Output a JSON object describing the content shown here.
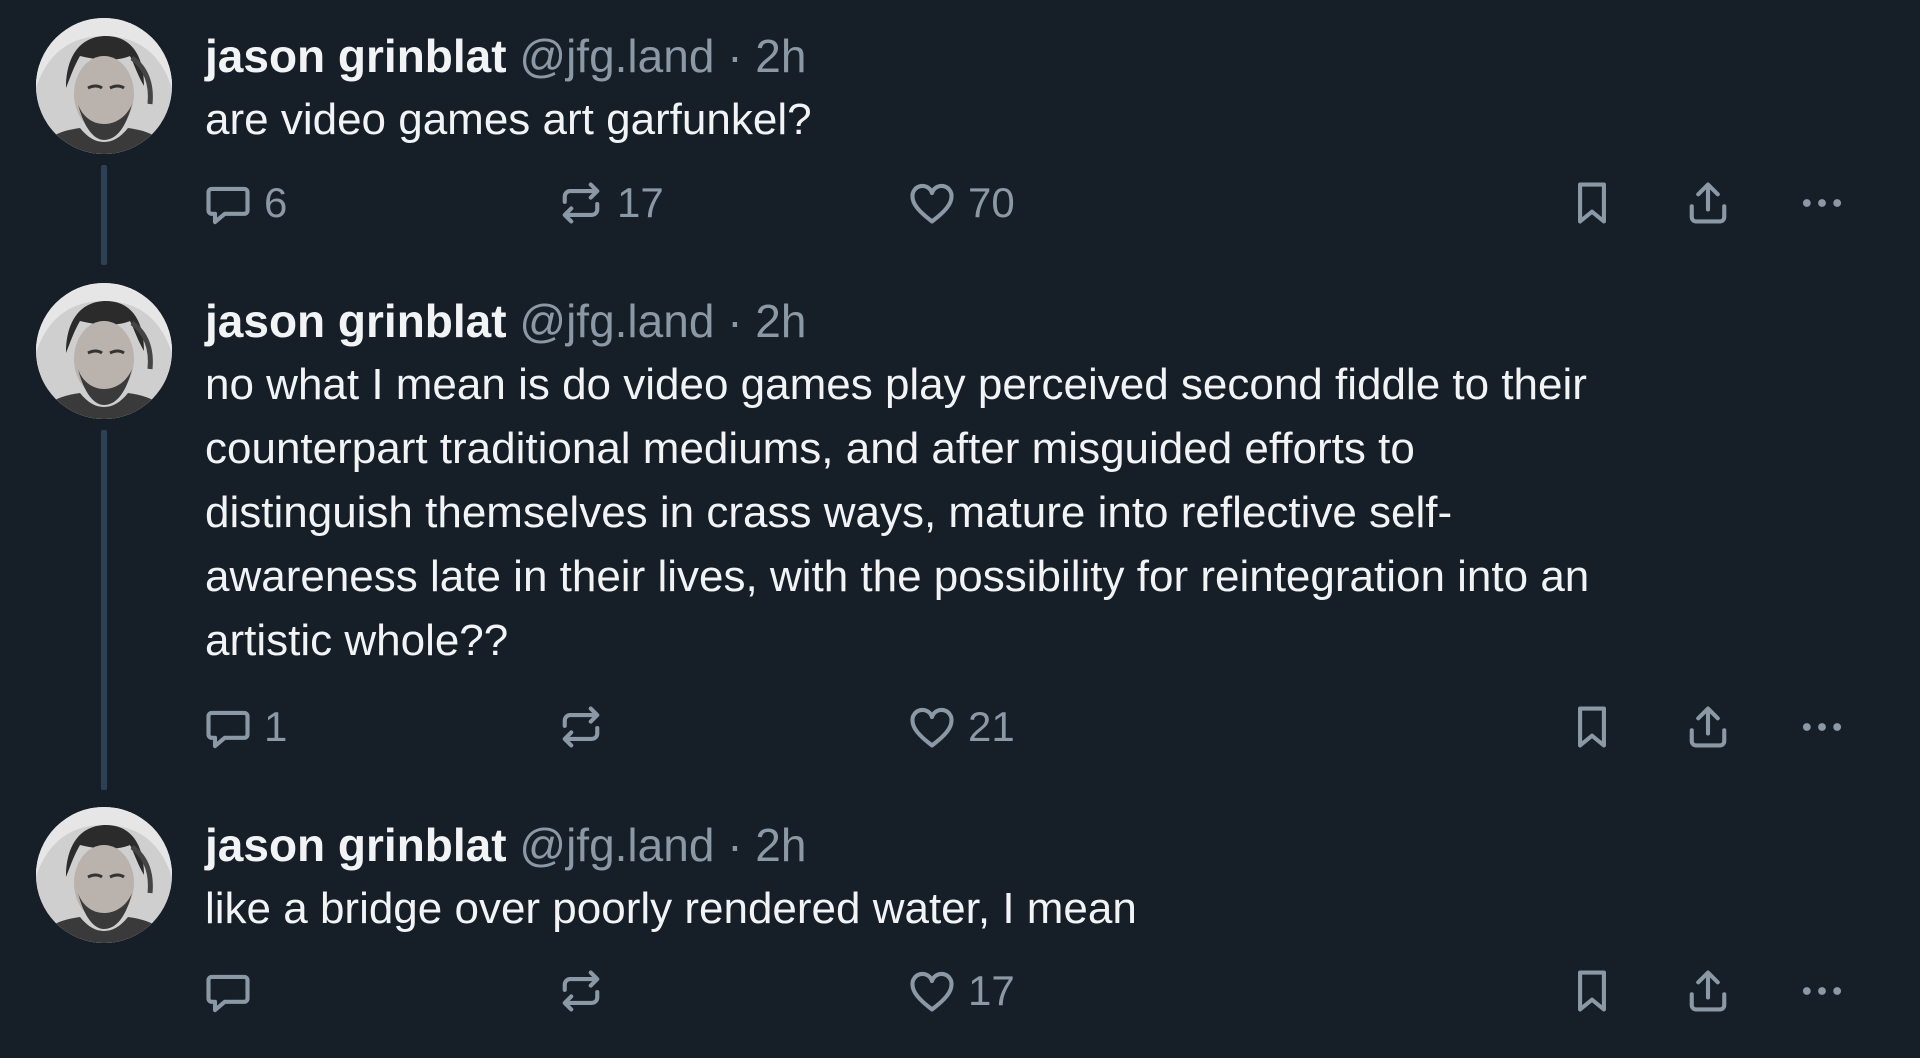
{
  "posts": [
    {
      "author_name": "jason grinblat",
      "handle": "@jfg.land",
      "separator": "·",
      "time": "2h",
      "text": "are video games art garfunkel?",
      "reply_count": "6",
      "repost_count": "17",
      "like_count": "70"
    },
    {
      "author_name": "jason grinblat",
      "handle": "@jfg.land",
      "separator": "·",
      "time": "2h",
      "text_lines": [
        "no what I mean is do video games play perceived second fiddle to their",
        "counterpart traditional mediums, and after misguided efforts to",
        "distinguish themselves in crass ways, mature into reflective self-",
        "awareness late in their lives, with the possibility for reintegration into an",
        "artistic whole??"
      ],
      "reply_count": "1",
      "repost_count": "",
      "like_count": "21"
    },
    {
      "author_name": "jason grinblat",
      "handle": "@jfg.land",
      "separator": "·",
      "time": "2h",
      "text": "like a bridge over poorly rendered water, I mean",
      "reply_count": "",
      "repost_count": "",
      "like_count": "17"
    }
  ],
  "icons": {
    "reply": "speech-bubble-icon",
    "repost": "repost-arrows-icon",
    "like": "heart-icon",
    "bookmark": "bookmark-icon",
    "share": "share-upload-icon",
    "more": "more-dots-icon"
  },
  "colors": {
    "background": "#161e27",
    "text_primary": "#f1f3f5",
    "text_secondary": "#8b98a5",
    "thread_line": "#2e4154"
  }
}
